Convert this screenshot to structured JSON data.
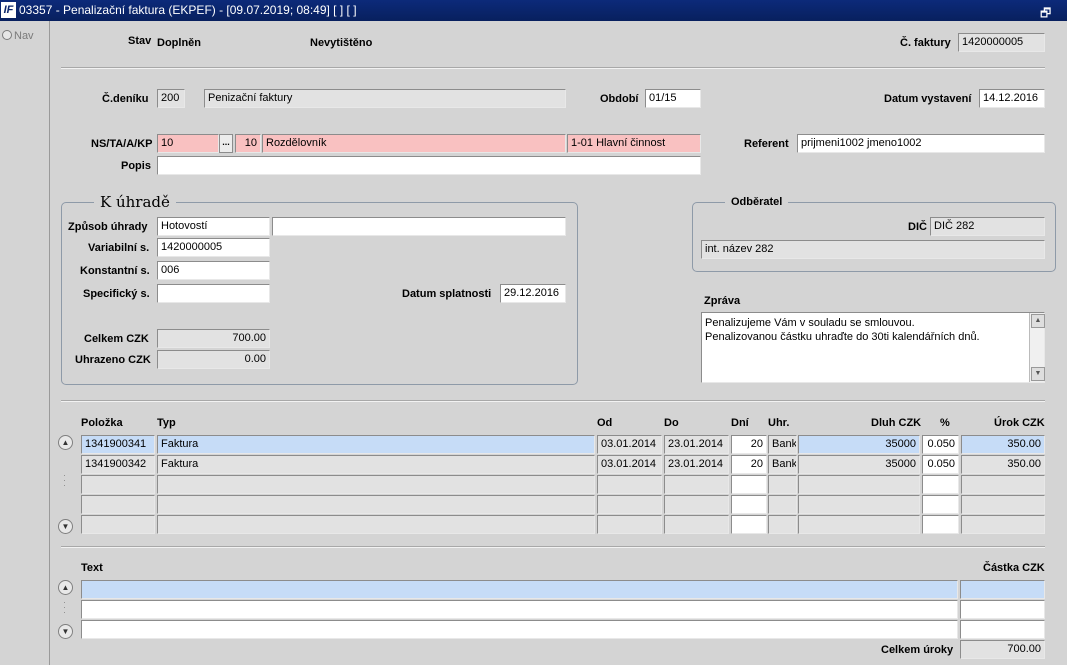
{
  "window": {
    "title": "03357 - Penalizační faktura (EKPEF) - [09.07.2019; 08:49]  [ ]  [ ]",
    "logo_text": "IF",
    "restore_icon": "restore-icon",
    "close_icon": "close-icon"
  },
  "nav": {
    "label": "Nav"
  },
  "header": {
    "stav_label": "Stav",
    "stav_value": "Doplněn",
    "print_status": "Nevytištěno",
    "faktura_label": "Č. faktury",
    "faktura_value": "1420000005"
  },
  "journal": {
    "denik_label": "Č.deníku",
    "denik_value": "200",
    "denik_name": "Penizační faktury",
    "obdobi_label": "Období",
    "obdobi_value": "01/15",
    "datum_vystaveni_label": "Datum vystavení",
    "datum_vystaveni_value": "14.12.2016"
  },
  "ns": {
    "label": "NS/TA/A/KP",
    "ns_value": "10",
    "ellipsis": "...",
    "ta_value": "10",
    "ta_name": "Rozdělovník",
    "activity": "1-01 Hlavní činnost",
    "referent_label": "Referent",
    "referent_value": "prijmeni1002 jmeno1002",
    "popis_label": "Popis",
    "popis_value": ""
  },
  "payment": {
    "title": "K úhradě",
    "zpusob_label": "Způsob úhrady",
    "zpusob_value": "Hotovostí",
    "zpusob_extra": "",
    "variabilni_label": "Variabilní s.",
    "variabilni_value": "1420000005",
    "konstantni_label": "Konstantní s.",
    "konstantni_value": "006",
    "specificky_label": "Specifický s.",
    "specificky_value": "",
    "splatnost_label": "Datum splatnosti",
    "splatnost_value": "29.12.2016",
    "celkem_label": "Celkem CZK",
    "celkem_value": "700.00",
    "uhrazeno_label": "Uhrazeno CZK",
    "uhrazeno_value": "0.00"
  },
  "customer": {
    "title": "Odběratel",
    "dic_label": "DIČ",
    "dic_value": "DIČ 282",
    "name": "int. název 282"
  },
  "message": {
    "label": "Zpráva",
    "line1": "Penalizujeme Vám v souladu se smlouvou.",
    "line2": "Penalizovanou částku uhraďte do 30ti kalendářních dnů."
  },
  "items": {
    "headers": {
      "polozka": "Položka",
      "typ": "Typ",
      "od": "Od",
      "do": "Do",
      "dni": "Dní",
      "uhr": "Uhr.",
      "dluh": "Dluh CZK",
      "pct": "%",
      "urok": "Úrok CZK"
    },
    "rows": [
      {
        "polozka": "1341900341",
        "typ": "Faktura",
        "od": "03.01.2014",
        "do": "23.01.2014",
        "dni": "20",
        "uhr": "Bank",
        "dluh": "35000",
        "pct": "0.050",
        "urok": "350.00"
      },
      {
        "polozka": "1341900342",
        "typ": "Faktura",
        "od": "03.01.2014",
        "do": "23.01.2014",
        "dni": "20",
        "uhr": "Bank",
        "dluh": "35000",
        "pct": "0.050",
        "urok": "350.00"
      }
    ]
  },
  "texts": {
    "text_label": "Text",
    "castka_label": "Částka CZK",
    "celkem_uroky_label": "Celkem úroky",
    "celkem_uroky_value": "700.00"
  },
  "colors": {
    "title_bar": "#0a246a",
    "pink_field": "#f9c1c1",
    "selected_row": "#c6dcf7",
    "background": "#d4d4d4"
  }
}
